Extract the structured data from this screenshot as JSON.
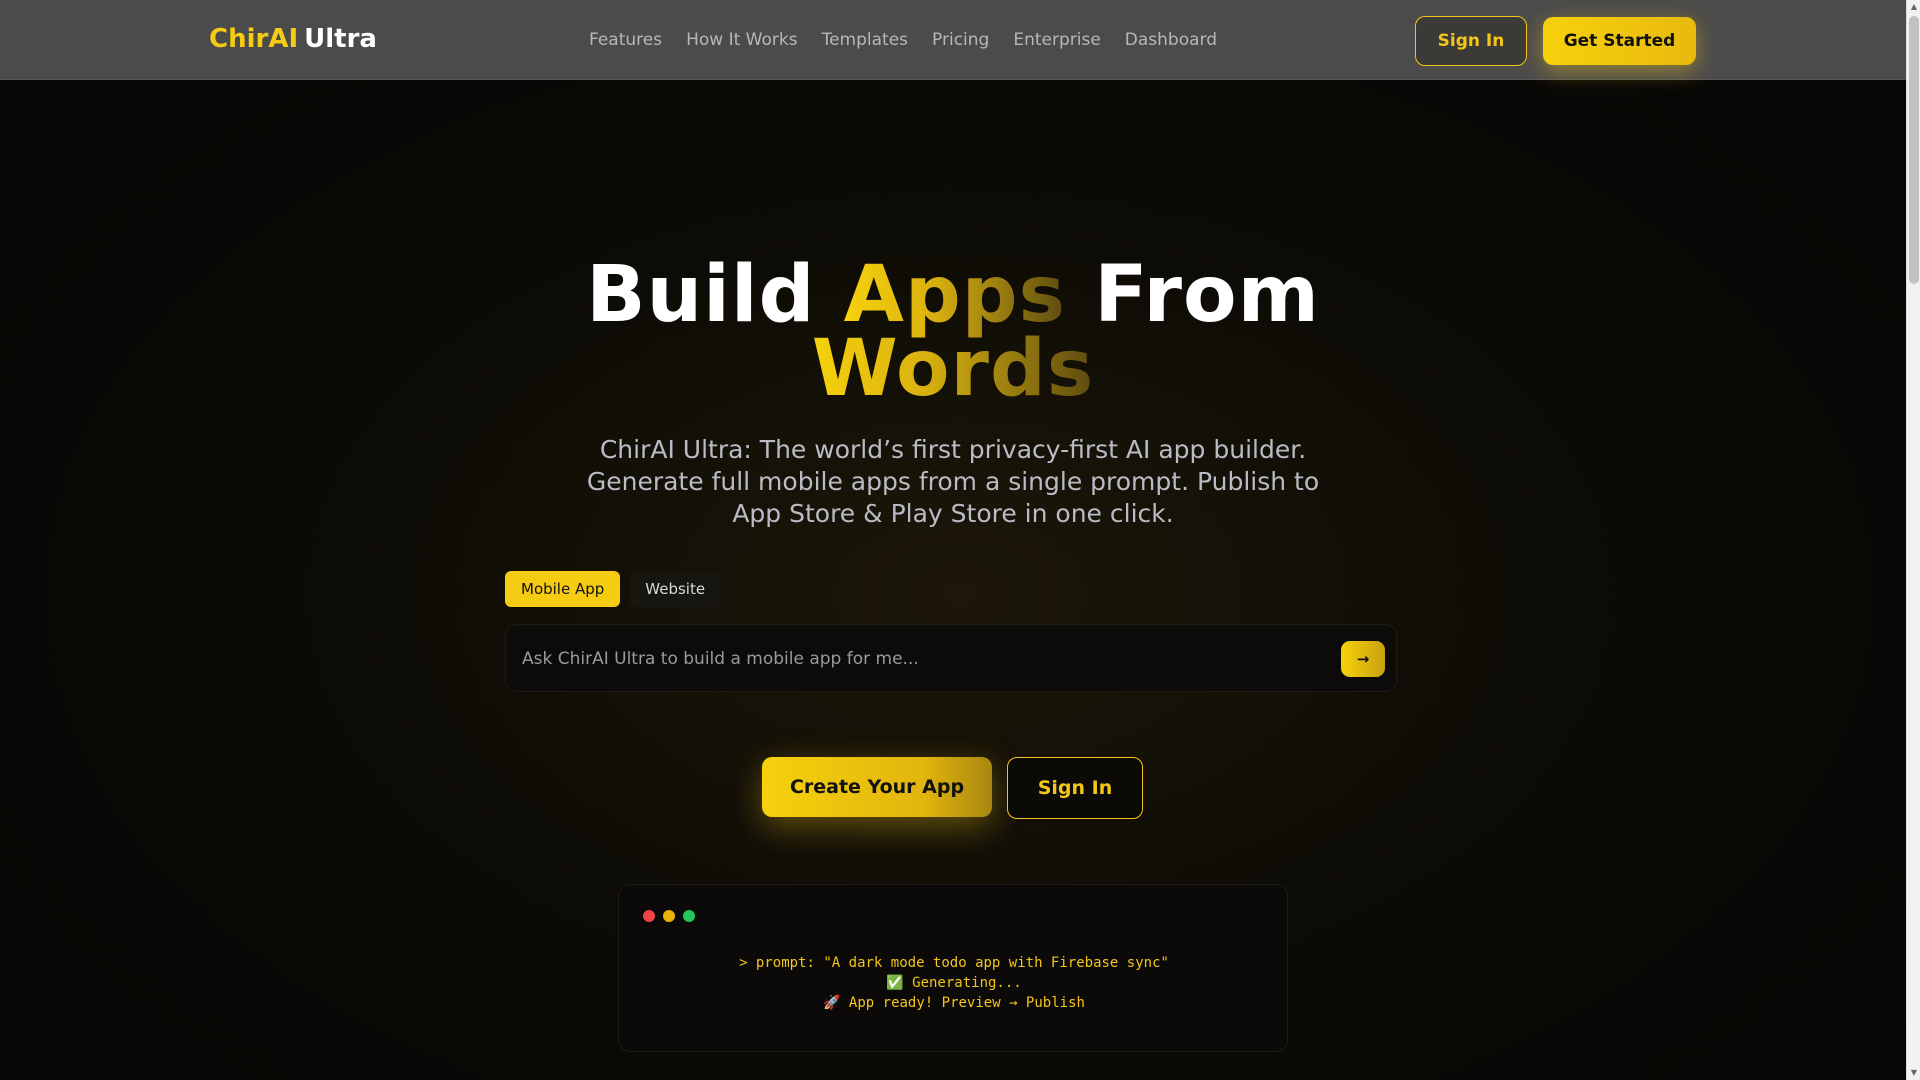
{
  "nav": {
    "logo_primary": "ChirAI",
    "logo_secondary": "Ultra",
    "links": [
      "Features",
      "How It Works",
      "Templates",
      "Pricing",
      "Enterprise",
      "Dashboard"
    ],
    "sign_in": "Sign In",
    "get_started": "Get Started"
  },
  "hero": {
    "title_1": "Build",
    "title_2": "Apps",
    "title_3": "From",
    "title_4": "Words",
    "subtitle": "ChirAI Ultra: The world’s first privacy-first AI app builder. Generate full mobile apps from a single prompt. Publish to App Store & Play Store in one click."
  },
  "mode_tabs": {
    "active": "Mobile App",
    "inactive": "Website"
  },
  "prompt": {
    "placeholder": "Ask ChirAI Ultra to build a mobile app for me...",
    "value": "",
    "send_label": "→"
  },
  "cta": {
    "create": "Create Your App",
    "sign_in": "Sign In"
  },
  "terminal": {
    "line1": "> prompt: \"A dark mode todo app with Firebase sync\"",
    "line2": "✅ Generating...",
    "line3": "🚀 App ready! Preview → Publish"
  },
  "colors": {
    "accent": "#f5c518",
    "nav_bg": "#4b4b4b",
    "page_bg": "#050505"
  }
}
